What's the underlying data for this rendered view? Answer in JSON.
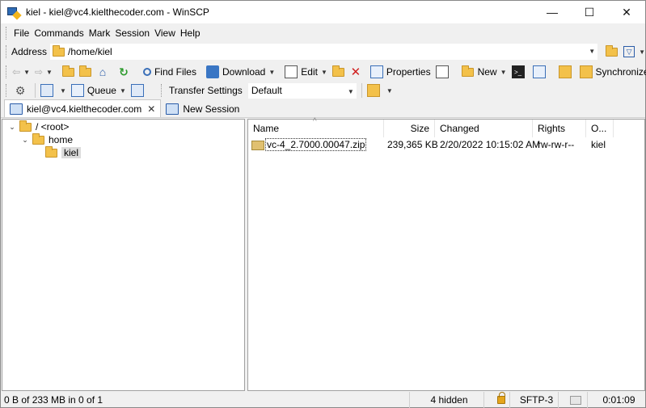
{
  "window": {
    "title": "kiel - kiel@vc4.kielthecoder.com - WinSCP",
    "minimize": "—",
    "maximize": "☐",
    "close": "✕"
  },
  "menu": [
    "File",
    "Commands",
    "Mark",
    "Session",
    "View",
    "Help"
  ],
  "address": {
    "label": "Address",
    "value": "/home/kiel"
  },
  "toolbar1": {
    "find_files": "Find Files",
    "download": "Download",
    "edit": "Edit",
    "properties": "Properties",
    "new": "New",
    "synchronize": "Synchronize"
  },
  "toolbar2": {
    "queue": "Queue",
    "transfer_settings_label": "Transfer Settings",
    "transfer_settings_value": "Default"
  },
  "tabs": [
    {
      "label": "kiel@vc4.kielthecoder.com",
      "active": true
    },
    {
      "label": "New Session",
      "active": false
    }
  ],
  "tree": [
    {
      "label": "/ <root>",
      "expanded": true
    },
    {
      "label": "home",
      "expanded": true
    },
    {
      "label": "kiel",
      "selected": true
    }
  ],
  "file_list": {
    "columns": [
      "Name",
      "Size",
      "Changed",
      "Rights",
      "O..."
    ],
    "rows": [
      {
        "name": "vc-4_2.7000.00047.zip",
        "size": "239,365 KB",
        "changed": "2/20/2022 10:15:02 AM",
        "rights": "rw-rw-r--",
        "owner": "kiel"
      }
    ]
  },
  "status": {
    "selection": "0 B of 233 MB in 0 of 1",
    "hidden": "4 hidden",
    "protocol": "SFTP-3",
    "elapsed": "0:01:09"
  },
  "icons": {
    "app": "winscp-icon",
    "folder": "folder-icon",
    "zip": "zip-file-icon",
    "lock": "lock-icon"
  }
}
